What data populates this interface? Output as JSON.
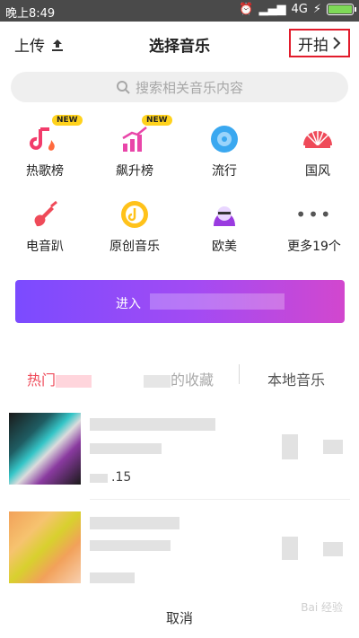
{
  "status_bar": {
    "time": "晚上8:49",
    "network": "4G"
  },
  "header": {
    "upload_label": "上传",
    "title": "选择音乐",
    "start_label": "开拍"
  },
  "search": {
    "placeholder": "搜索相关音乐内容"
  },
  "categories": [
    {
      "label": "热歌榜",
      "badge": "NEW",
      "icon": "hot-songs-icon"
    },
    {
      "label": "飙升榜",
      "badge": "NEW",
      "icon": "rising-chart-icon"
    },
    {
      "label": "流行",
      "icon": "pop-disc-icon"
    },
    {
      "label": "国风",
      "icon": "fan-icon"
    },
    {
      "label": "电音趴",
      "icon": "guitar-icon"
    },
    {
      "label": "原创音乐",
      "icon": "original-music-icon"
    },
    {
      "label": "欧美",
      "icon": "western-avatar-icon"
    },
    {
      "label": "更多19个",
      "icon": "more-icon"
    }
  ],
  "banner": {
    "text": "进入"
  },
  "tabs": {
    "hot_prefix": "热门",
    "fav_suffix": "的收藏",
    "local": "本地音乐"
  },
  "songs": [
    {
      "duration_fragment": ".15"
    }
  ],
  "footer": {
    "cancel": "取消"
  },
  "watermark": "Bai 经验",
  "colors": {
    "accent_red": "#e21c2c",
    "active_tab": "#ef4a59",
    "banner_start": "#7b4bff",
    "banner_end": "#d247ce"
  }
}
